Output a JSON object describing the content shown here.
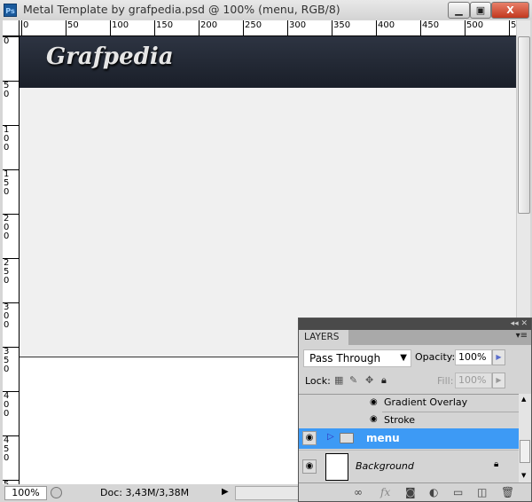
{
  "window": {
    "title": "Metal Template by grafpedia.psd @ 100% (menu, RGB/8)",
    "app_icon": "Ps",
    "buttons": {
      "minimize": "▁",
      "maximize": "▣",
      "close": "X"
    }
  },
  "rulers": {
    "horizontal": [
      "0",
      "50",
      "100",
      "150",
      "200",
      "250",
      "300",
      "350",
      "400",
      "450",
      "500",
      "5"
    ],
    "vertical": [
      "0",
      "5\n0",
      "1\n0\n0",
      "1\n5\n0",
      "2\n0\n0",
      "2\n5\n0",
      "3\n0\n0",
      "3\n5\n0",
      "4\n0\n0",
      "4\n5\n0",
      "5"
    ]
  },
  "canvas": {
    "logo": "Grafpedia",
    "header_color": "#232935"
  },
  "status": {
    "zoom": "100%",
    "doc": "Doc: 3,43M/3,38M",
    "arrow": "▶"
  },
  "layers_panel": {
    "collapse_icons": "◂◂ ✕",
    "tab": "LAYERS",
    "menu_icon": "▾≡",
    "blend_mode": "Pass Through",
    "opacity_label": "Opacity:",
    "opacity": "100%",
    "lock_label": "Lock:",
    "fill_label": "Fill:",
    "fill": "100%",
    "effects": [
      "Gradient Overlay",
      "Stroke"
    ],
    "layers": [
      {
        "name": "menu",
        "type": "group",
        "selected": true
      },
      {
        "name": "Background",
        "type": "image",
        "locked": true
      }
    ],
    "accent": "#3d9af5"
  }
}
